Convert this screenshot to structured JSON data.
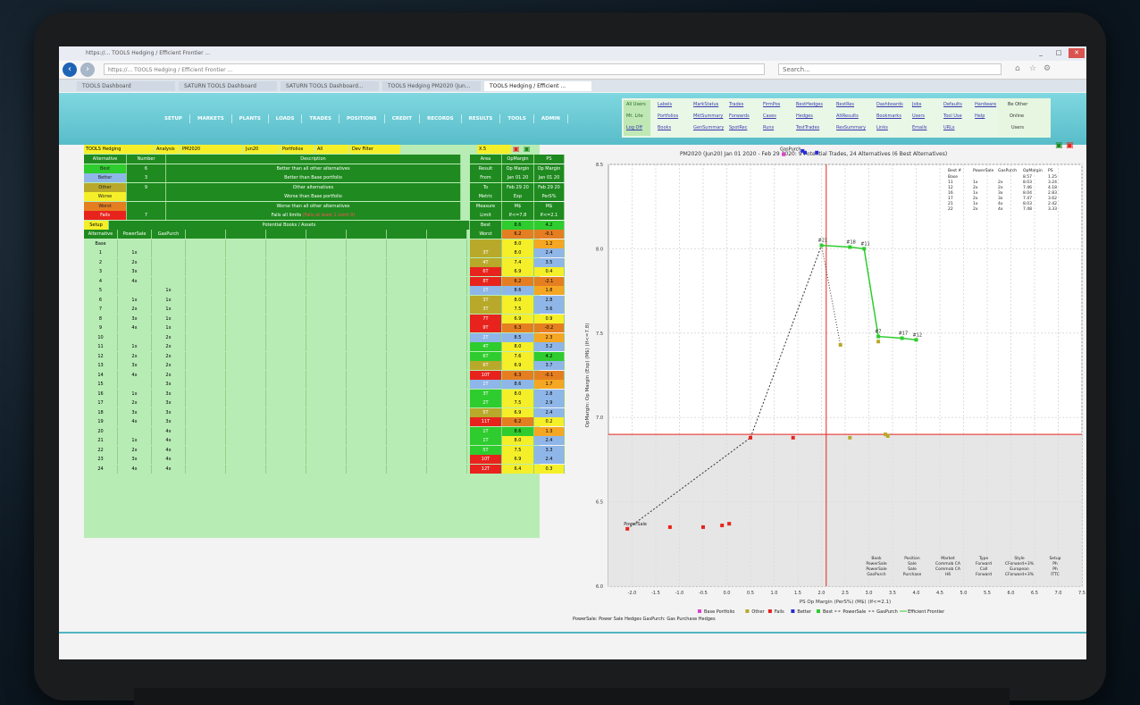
{
  "browser": {
    "address": "https://... TOOLS Hedging / Efficient Frontier ...",
    "search_placeholder": "Search...",
    "tabs": [
      "TOOLS Dashboard",
      "SATURN TOOLS Dashboard",
      "SATURN TOOLS Dashboard...",
      "TOOLS Hedging PM2020 (Jun...",
      "TOOLS Hedging / Efficient ..."
    ],
    "window_buttons": [
      "_",
      "□",
      "✕"
    ]
  },
  "menu": [
    "SETUP",
    "MARKETS",
    "PLANTS",
    "LOADS",
    "TRADES",
    "POSITIONS",
    "CREDIT",
    "RECORDS",
    "RESULTS",
    "TOOLS",
    "ADMIN"
  ],
  "top_links": {
    "col1": [
      "All Users",
      "Mt. Lite",
      "Log Off"
    ],
    "col2": [
      "Labels",
      "Portfolios",
      "Books"
    ],
    "col3": [
      "MarkStatus",
      "MktSummary",
      "GenSummary"
    ],
    "col4": [
      "Trades",
      "Forwards",
      "SpotRec"
    ],
    "col5": [
      "FirmPos",
      "Cases",
      "Runs"
    ],
    "col6": [
      "BestHedges",
      "Hedges",
      "TestTrades"
    ],
    "col7": [
      "BestRes",
      "AltResults",
      "ResSummary"
    ],
    "col8": [
      "Dashboards",
      "Bookmarks",
      "Links"
    ],
    "col9": [
      "Jobs",
      "Users",
      "Emails"
    ],
    "col10": [
      "Defaults",
      "Tool Use",
      "URLs"
    ],
    "col11": [
      "Hardware",
      "Help",
      ""
    ],
    "side": [
      "Be Other",
      "Online",
      "Users"
    ]
  },
  "controls": {
    "tool": "TOOLS Hedging",
    "analysis": "Analysis",
    "portfolio_name": "PM2020",
    "period": "Jun20",
    "portfolio_label": "Portfolios",
    "filter": "All",
    "filter2": "Dev Filter",
    "version": "X.5"
  },
  "legend": {
    "headers": [
      "Alternative",
      "Number",
      "Description"
    ],
    "rows": [
      {
        "label": "Best",
        "number": "6",
        "desc": "Better than all other alternatives",
        "color": "#2ecc2e"
      },
      {
        "label": "Better",
        "number": "3",
        "desc": "Better than Base portfolio",
        "color": "#8fb6e8"
      },
      {
        "label": "Other",
        "number": "9",
        "desc": "Other alternatives",
        "color": "#b8a92a"
      },
      {
        "label": "Worse",
        "number": "",
        "desc": "Worse than Base portfolio",
        "color": "#f5ef29"
      },
      {
        "label": "Worst",
        "number": "",
        "desc": "Worse than all other alternatives",
        "color": "#e57e21"
      },
      {
        "label": "Fails",
        "number": "7",
        "desc": "Fails all limits",
        "desc_red": "(Fails at least 1 Limit 0)",
        "color": "#e8231d"
      }
    ],
    "potential": "Potential Books / Assets",
    "setup": "Setup"
  },
  "area_table": {
    "headers": [
      "Area",
      "OpMargin",
      "PS"
    ],
    "rows": [
      [
        "Result",
        "Op Margin",
        "Op Margin"
      ],
      [
        "From",
        "Jan 01 20",
        "Jan 01 20"
      ],
      [
        "To",
        "Feb 29 20",
        "Feb 29 20"
      ],
      [
        "Metric",
        "Exp",
        "PerS%"
      ],
      [
        "Measure",
        "M$",
        "M$"
      ],
      [
        "Limit",
        "If<=7.8",
        "If<=2.1"
      ],
      [
        "Best",
        "8.6",
        "4.2"
      ],
      [
        "Worst",
        "6.2",
        "-0.1"
      ]
    ]
  },
  "alt_headers": [
    "Alternative",
    "PowerSale",
    "GasPurch"
  ],
  "alternatives": [
    {
      "id": "Base",
      "ps": "",
      "gp": "",
      "area": "",
      "op": "8.0",
      "psv": "1.2",
      "area_c": "#b8a92a",
      "op_c": "#f5ef29",
      "ps_c": "#f5a623"
    },
    {
      "id": "1",
      "ps": "1x",
      "gp": "",
      "area": "3T",
      "op": "8.0",
      "psv": "2.4",
      "area_c": "#b8a92a",
      "op_c": "#f5ef29",
      "ps_c": "#8fb6e8"
    },
    {
      "id": "2",
      "ps": "2x",
      "gp": "",
      "area": "4T",
      "op": "7.4",
      "psv": "3.5",
      "area_c": "#b8a92a",
      "op_c": "#f5ef29",
      "ps_c": "#8fb6e8"
    },
    {
      "id": "3",
      "ps": "3x",
      "gp": "",
      "area": "6T",
      "op": "6.9",
      "psv": "0.4",
      "area_c": "#e8231d",
      "op_c": "#f5ef29",
      "ps_c": "#f5ef29"
    },
    {
      "id": "4",
      "ps": "4x",
      "gp": "",
      "area": "8T",
      "op": "6.2",
      "psv": "-2.1",
      "area_c": "#e8231d",
      "op_c": "#e57e21",
      "ps_c": "#e57e21"
    },
    {
      "id": "5",
      "ps": "",
      "gp": "1x",
      "area": "1T",
      "op": "8.6",
      "psv": "1.8",
      "area_c": "#8fb6e8",
      "op_c": "#8fb6e8",
      "ps_c": "#f5a623"
    },
    {
      "id": "6",
      "ps": "1x",
      "gp": "1x",
      "area": "3T",
      "op": "8.0",
      "psv": "2.8",
      "area_c": "#b8a92a",
      "op_c": "#f5ef29",
      "ps_c": "#8fb6e8"
    },
    {
      "id": "7",
      "ps": "2x",
      "gp": "1x",
      "area": "3T",
      "op": "7.5",
      "psv": "3.6",
      "area_c": "#b8a92a",
      "op_c": "#f5ef29",
      "ps_c": "#8fb6e8"
    },
    {
      "id": "8",
      "ps": "3x",
      "gp": "1x",
      "area": "7T",
      "op": "6.9",
      "psv": "0.9",
      "area_c": "#e8231d",
      "op_c": "#f5ef29",
      "ps_c": "#f5ef29"
    },
    {
      "id": "9",
      "ps": "4x",
      "gp": "1x",
      "area": "9T",
      "op": "6.3",
      "psv": "-0.2",
      "area_c": "#e8231d",
      "op_c": "#e57e21",
      "ps_c": "#e57e21"
    },
    {
      "id": "10",
      "ps": "",
      "gp": "2x",
      "area": "2T",
      "op": "8.5",
      "psv": "2.3",
      "area_c": "#8fb6e8",
      "op_c": "#8fb6e8",
      "ps_c": "#f5a623"
    },
    {
      "id": "11",
      "ps": "1x",
      "gp": "2x",
      "area": "4T",
      "op": "8.0",
      "psv": "3.2",
      "area_c": "#2ecc2e",
      "op_c": "#f5ef29",
      "ps_c": "#8fb6e8"
    },
    {
      "id": "12",
      "ps": "2x",
      "gp": "2x",
      "area": "6T",
      "op": "7.6",
      "psv": "4.2",
      "area_c": "#2ecc2e",
      "op_c": "#f5ef29",
      "ps_c": "#2ecc2e"
    },
    {
      "id": "13",
      "ps": "3x",
      "gp": "2x",
      "area": "6T",
      "op": "6.9",
      "psv": "3.7",
      "area_c": "#b8a92a",
      "op_c": "#f5ef29",
      "ps_c": "#8fb6e8"
    },
    {
      "id": "14",
      "ps": "4x",
      "gp": "2x",
      "area": "10T",
      "op": "6.3",
      "psv": "-0.1",
      "area_c": "#e8231d",
      "op_c": "#e57e21",
      "ps_c": "#e57e21"
    },
    {
      "id": "15",
      "ps": "",
      "gp": "3x",
      "area": "1T",
      "op": "8.6",
      "psv": "1.7",
      "area_c": "#8fb6e8",
      "op_c": "#8fb6e8",
      "ps_c": "#f5a623"
    },
    {
      "id": "16",
      "ps": "1x",
      "gp": "3x",
      "area": "3T",
      "op": "8.0",
      "psv": "2.8",
      "area_c": "#2ecc2e",
      "op_c": "#f5ef29",
      "ps_c": "#8fb6e8"
    },
    {
      "id": "17",
      "ps": "2x",
      "gp": "3x",
      "area": "2T",
      "op": "7.5",
      "psv": "2.9",
      "area_c": "#2ecc2e",
      "op_c": "#f5ef29",
      "ps_c": "#8fb6e8"
    },
    {
      "id": "18",
      "ps": "3x",
      "gp": "3x",
      "area": "5T",
      "op": "6.9",
      "psv": "2.4",
      "area_c": "#b8a92a",
      "op_c": "#f5ef29",
      "ps_c": "#8fb6e8"
    },
    {
      "id": "19",
      "ps": "4x",
      "gp": "3x",
      "area": "11T",
      "op": "6.2",
      "psv": "0.2",
      "area_c": "#e8231d",
      "op_c": "#e57e21",
      "ps_c": "#f5ef29"
    },
    {
      "id": "20",
      "ps": "",
      "gp": "4x",
      "area": "1T",
      "op": "8.6",
      "psv": "1.3",
      "area_c": "#2ecc2e",
      "op_c": "#2ecc2e",
      "ps_c": "#f5a623"
    },
    {
      "id": "21",
      "ps": "1x",
      "gp": "4x",
      "area": "1T",
      "op": "8.0",
      "psv": "2.4",
      "area_c": "#2ecc2e",
      "op_c": "#f5ef29",
      "ps_c": "#8fb6e8"
    },
    {
      "id": "22",
      "ps": "2x",
      "gp": "4x",
      "area": "5T",
      "op": "7.5",
      "psv": "3.3",
      "area_c": "#2ecc2e",
      "op_c": "#f5ef29",
      "ps_c": "#8fb6e8"
    },
    {
      "id": "23",
      "ps": "3x",
      "gp": "4x",
      "area": "10T",
      "op": "6.9",
      "psv": "2.4",
      "area_c": "#e8231d",
      "op_c": "#f5ef29",
      "ps_c": "#8fb6e8"
    },
    {
      "id": "24",
      "ps": "4x",
      "gp": "4x",
      "area": "12T",
      "op": "6.4",
      "psv": "0.3",
      "area_c": "#e8231d",
      "op_c": "#f5ef29",
      "ps_c": "#f5ef29"
    }
  ],
  "chart_data": {
    "type": "scatter",
    "title": "PM2020 (Jun20) Jan 01 2020 - Feb 29 2020: 9 Potential Trades, 24 Alternatives (6 Best Alternatives)",
    "xlabel": "PS Op Margin (PerS%) (M$) (If<=2.1)",
    "ylabel": "OpMargin: Op Margin (Exp) (M$) (If<=7.8)",
    "xlim": [
      -2.5,
      7.5
    ],
    "ylim": [
      6.0,
      8.5
    ],
    "xticks": [
      "-2.0",
      "-1.5",
      "-1.0",
      "-0.5",
      "0.0",
      "0.5",
      "1.0",
      "1.5",
      "2.0",
      "2.5",
      "3.0",
      "3.5",
      "4.0",
      "4.5",
      "5.0",
      "5.5",
      "6.0",
      "6.5",
      "7.0",
      "7.5"
    ],
    "yticks": [
      "6.0",
      "6.5",
      "7.0",
      "7.5",
      "8.0",
      "8.5"
    ],
    "limit_x": 2.1,
    "limit_y": 7.8,
    "series": [
      {
        "name": "Base Portfolio",
        "color": "#e040d0",
        "points": [
          [
            1.2,
            8.56
          ]
        ]
      },
      {
        "name": "Other",
        "color": "#b8a92a",
        "points": [
          [
            2.4,
            7.43
          ],
          [
            2.6,
            6.88
          ],
          [
            3.35,
            6.9
          ],
          [
            3.4,
            6.89
          ],
          [
            3.2,
            7.45
          ]
        ]
      },
      {
        "name": "Fails",
        "color": "#e8231d",
        "points": [
          [
            -2.1,
            6.34
          ],
          [
            -1.2,
            6.35
          ],
          [
            -0.5,
            6.35
          ],
          [
            -0.1,
            6.36
          ],
          [
            0.05,
            6.37
          ],
          [
            0.5,
            6.88
          ],
          [
            1.4,
            6.88
          ]
        ]
      },
      {
        "name": "Better",
        "color": "#2a2ad8",
        "points": [
          [
            1.6,
            8.58
          ],
          [
            1.65,
            8.57
          ],
          [
            1.9,
            8.57
          ]
        ]
      },
      {
        "name": "Best",
        "color": "#2ecc2e",
        "points": [
          [
            2.0,
            8.02
          ],
          [
            2.6,
            8.01
          ],
          [
            2.9,
            8.0
          ],
          [
            3.2,
            7.48
          ],
          [
            3.7,
            7.47
          ],
          [
            4.0,
            7.46
          ]
        ]
      }
    ],
    "frontier": [
      [
        2.0,
        8.02
      ],
      [
        2.6,
        8.01
      ],
      [
        2.9,
        8.0
      ],
      [
        3.2,
        7.48
      ],
      [
        3.7,
        7.47
      ],
      [
        4.0,
        7.46
      ]
    ],
    "powersale_path": [
      [
        -2.1,
        6.34
      ],
      [
        0.5,
        6.88
      ],
      [
        2.0,
        8.02
      ]
    ],
    "gaspurch_path": [
      [
        2.0,
        8.02
      ],
      [
        2.4,
        7.43
      ]
    ],
    "point_labels": [
      {
        "text": "#21",
        "x": 2.0,
        "y": 8.02
      },
      {
        "text": "#18",
        "x": 2.6,
        "y": 8.01
      },
      {
        "text": "#11",
        "x": 2.9,
        "y": 8.0
      },
      {
        "text": "#7",
        "x": 3.2,
        "y": 7.48
      },
      {
        "text": "#17",
        "x": 3.7,
        "y": 7.47
      },
      {
        "text": "#12",
        "x": 4.0,
        "y": 7.46
      },
      {
        "text": "GasPurch",
        "x": 1.2,
        "y": 8.56
      },
      {
        "text": "PowerSale",
        "x": -2.1,
        "y": 6.34
      }
    ],
    "corner_table": {
      "headers": [
        "Best #",
        "PowerSale",
        "GasPurch",
        "OpMargin",
        "PS"
      ],
      "rows": [
        [
          "Base",
          "",
          "",
          "8.57",
          "1.25"
        ],
        [
          "11",
          "1x",
          "2x",
          "8.03",
          "3.24"
        ],
        [
          "12",
          "2x",
          "2x",
          "7.46",
          "4.18"
        ],
        [
          "16",
          "1x",
          "3x",
          "8.04",
          "2.83"
        ],
        [
          "17",
          "2x",
          "3x",
          "7.47",
          "3.62"
        ],
        [
          "21",
          "1x",
          "4x",
          "8.03",
          "2.42"
        ],
        [
          "22",
          "2x",
          "4x",
          "7.48",
          "3.33"
        ]
      ]
    },
    "legend": [
      "Base Portfolio",
      "Other",
      "Fails",
      "Better",
      "Best",
      "PowerSale",
      "GasPurch",
      "Efficient Frontier"
    ],
    "footnote": "PowerSale: Power Sale Hedges  GasPurch: Gas Purchase Hedges",
    "info_cols": [
      {
        "head": "Book",
        "lines": [
          "PowerSale",
          "PowerSale",
          "GasPurch"
        ]
      },
      {
        "head": "Position",
        "lines": [
          "Sale",
          "Sale",
          "Purchase"
        ]
      },
      {
        "head": "Market",
        "lines": [
          "Commob CA",
          "Commob CA",
          "H6"
        ]
      },
      {
        "head": "Type",
        "lines": [
          "Forward",
          "Call",
          "Forward"
        ]
      },
      {
        "head": "Style",
        "lines": [
          "CForward+3%",
          "European",
          "CForward+3%"
        ]
      },
      {
        "head": "Setup",
        "lines": [
          "Ph",
          "Ph",
          "ITTC"
        ]
      }
    ]
  }
}
